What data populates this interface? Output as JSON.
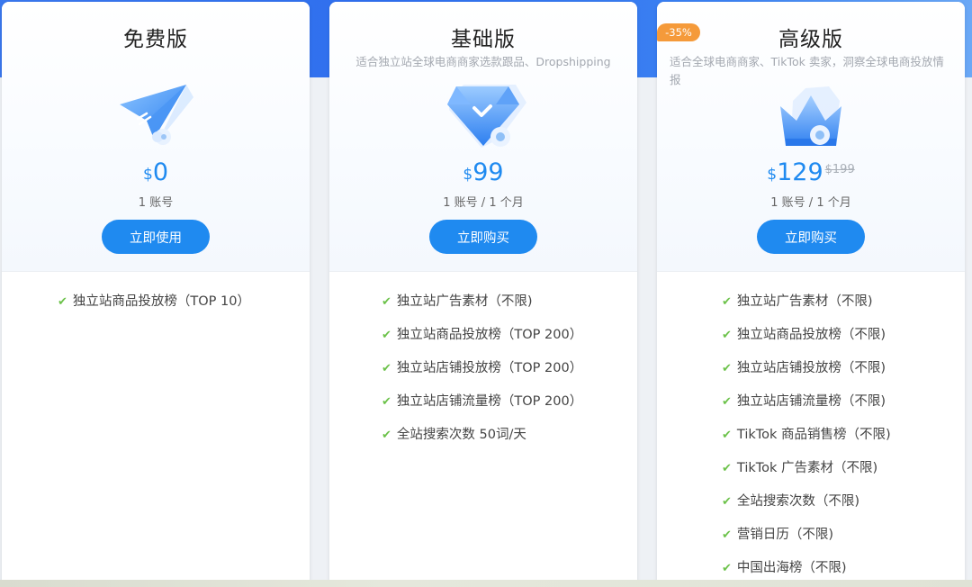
{
  "colors": {
    "accent": "#1f8af0",
    "check": "#6cc24a",
    "badge": "#f59a3a"
  },
  "plans": [
    {
      "title": "免费版",
      "subtitle": "",
      "icon": "paper-plane-icon",
      "currency": "$",
      "price": "0",
      "old_price": "",
      "unit": "1 账号",
      "cta": "立即使用",
      "features": [
        "独立站商品投放榜（TOP 10）"
      ]
    },
    {
      "title": "基础版",
      "subtitle": "适合独立站全球电商商家选款跟品、Dropshipping",
      "icon": "diamond-icon",
      "currency": "$",
      "price": "99",
      "old_price": "",
      "unit": "1 账号 / 1 个月",
      "cta": "立即购买",
      "features": [
        "独立站广告素材（不限)",
        "独立站商品投放榜（TOP 200）",
        "独立站店铺投放榜（TOP 200）",
        "独立站店铺流量榜（TOP 200）",
        "全站搜索次数 50词/天"
      ]
    },
    {
      "title": "高级版",
      "subtitle": "适合全球电商商家、TikTok 卖家，洞察全球电商投放情报",
      "icon": "crown-icon",
      "badge": "-35%",
      "currency": "$",
      "price": "129",
      "old_price": "$199",
      "unit": "1 账号 / 1 个月",
      "cta": "立即购买",
      "features": [
        "独立站广告素材（不限)",
        "独立站商品投放榜（不限)",
        "独立站店铺投放榜（不限)",
        "独立站店铺流量榜（不限)",
        "TikTok 商品销售榜（不限)",
        "TikTok 广告素材（不限)",
        "全站搜索次数（不限)",
        "营销日历（不限)",
        "中国出海榜（不限)"
      ]
    }
  ]
}
